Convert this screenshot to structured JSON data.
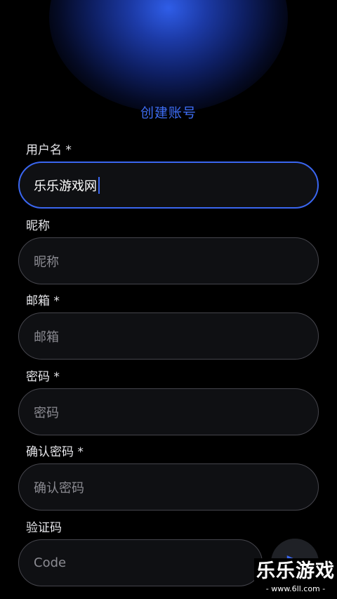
{
  "header": {
    "title": "创建账号"
  },
  "form": {
    "username": {
      "label": "用户名 *",
      "value": "乐乐游戏网"
    },
    "nickname": {
      "label": "昵称",
      "placeholder": "昵称"
    },
    "email": {
      "label": "邮箱 *",
      "placeholder": "邮箱"
    },
    "password": {
      "label": "密码 *",
      "placeholder": "密码"
    },
    "confirm_password": {
      "label": "确认密码 *",
      "placeholder": "确认密码"
    },
    "verification_code": {
      "label": "验证码",
      "placeholder": "Code"
    },
    "send_icon": "send-icon"
  },
  "watermark": {
    "main": "乐乐游戏",
    "sub": "- www.6ll.com -"
  },
  "colors": {
    "accent": "#3a66f0",
    "background": "#000000",
    "field_background": "#0f1013",
    "field_border": "#45454c",
    "placeholder": "#8b8b92"
  }
}
